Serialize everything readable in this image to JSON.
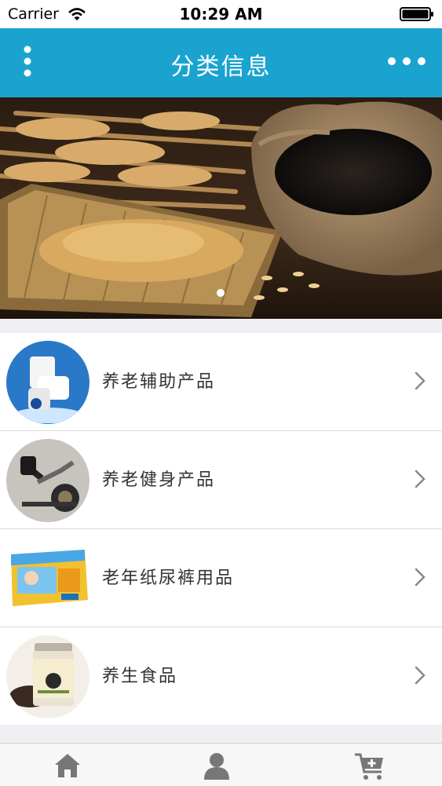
{
  "status_bar": {
    "carrier": "Carrier",
    "time": "10:29 AM",
    "wifi_icon": "wifi-icon",
    "battery_icon": "battery-icon"
  },
  "nav_bar": {
    "title": "分类信息",
    "left_icon": "vertical-dots-menu-icon",
    "right_icon": "horizontal-more-icon",
    "background": "#1aa3cf"
  },
  "banner": {
    "slide_count_indicator": "dot",
    "active_slide": 1
  },
  "categories": [
    {
      "label": "养老辅助产品",
      "thumb_icon": "toilet-chair-image"
    },
    {
      "label": "养老健身产品",
      "thumb_icon": "exercise-bike-image"
    },
    {
      "label": "老年纸尿裤用品",
      "thumb_icon": "diaper-package-image"
    },
    {
      "label": "养生食品",
      "thumb_icon": "health-food-jar-image"
    }
  ],
  "tab_bar": {
    "items": [
      {
        "name": "home",
        "icon": "home-icon"
      },
      {
        "name": "user",
        "icon": "user-icon"
      },
      {
        "name": "cart",
        "icon": "cart-add-icon"
      }
    ],
    "icon_color": "#777777"
  }
}
